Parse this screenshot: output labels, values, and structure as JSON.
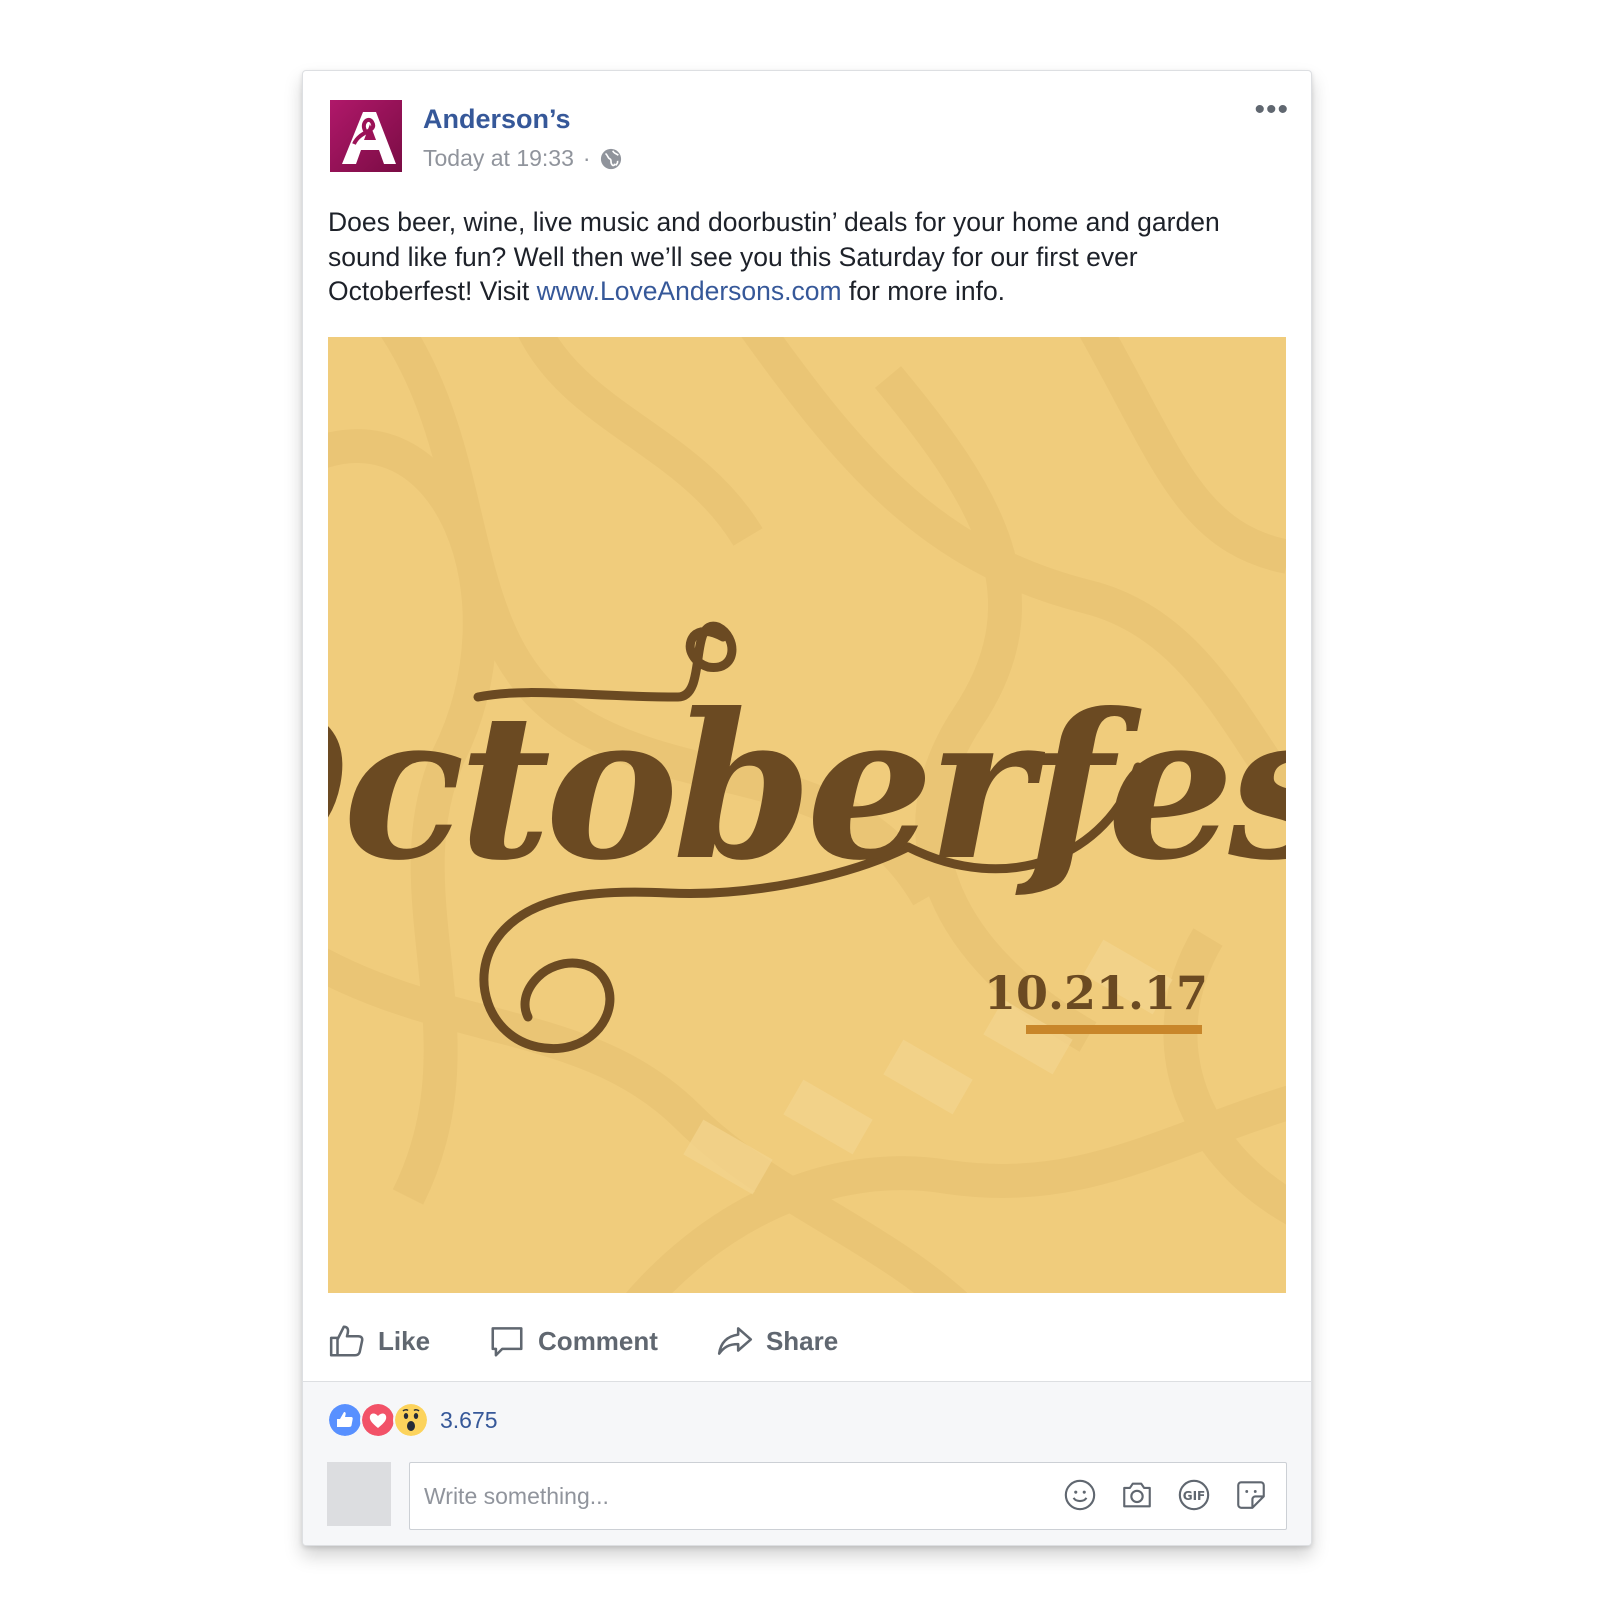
{
  "post": {
    "page_name": "Anderson’s",
    "timestamp": "Today at 19:33",
    "separator": "·",
    "audience_icon": "globe-icon",
    "menu_icon": "more-options-icon",
    "text_part1": "Does beer, wine, live music and doorbustin’ deals for your home and garden sound like fun? Well then we’ll see you this Saturday for our first ever Octoberfest! Visit ",
    "link_text": "www.LoveAndersons.com",
    "text_part2": " for more info."
  },
  "image": {
    "headline": "Octoberfest",
    "date": "10.21.17",
    "colors": {
      "background": "#f0cc7c",
      "lettering": "#6b4a22",
      "underline": "#c8862a"
    }
  },
  "actions": {
    "like": "Like",
    "comment": "Comment",
    "share": "Share"
  },
  "footer": {
    "reaction_icons": [
      "like-reaction-icon",
      "love-reaction-icon",
      "wow-reaction-icon"
    ],
    "reaction_count": "3.675",
    "comment_placeholder": "Write something..."
  },
  "colors": {
    "brand_blue": "#365899",
    "logo_magenta": "#9b1257",
    "like_blue": "#5890ff",
    "love_red": "#f25268"
  }
}
